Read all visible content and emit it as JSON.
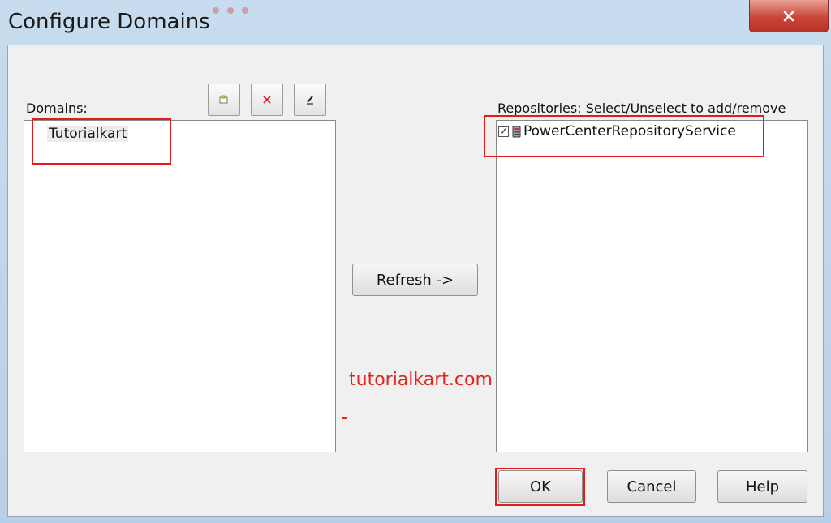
{
  "window": {
    "title": "Configure Domains",
    "close_icon": "close-icon"
  },
  "domains": {
    "label": "Domains:",
    "items": [
      "Tutorialkart"
    ],
    "toolbar": {
      "add_icon": "add-domain-icon",
      "remove_icon": "remove-domain-icon",
      "edit_icon": "edit-domain-icon"
    }
  },
  "refresh_label": "Refresh ->",
  "repositories": {
    "label": "Repositories: Select/Unselect to add/remove",
    "items": [
      {
        "label": "PowerCenterRepositoryService",
        "checked": true,
        "icon": "repository-icon"
      }
    ]
  },
  "buttons": {
    "ok": "OK",
    "cancel": "Cancel",
    "help": "Help"
  },
  "watermark": "tutorialkart.com",
  "colors": {
    "highlight": "#e21b1b",
    "close_button": "#c9463a",
    "watermark": "#e5231b"
  }
}
